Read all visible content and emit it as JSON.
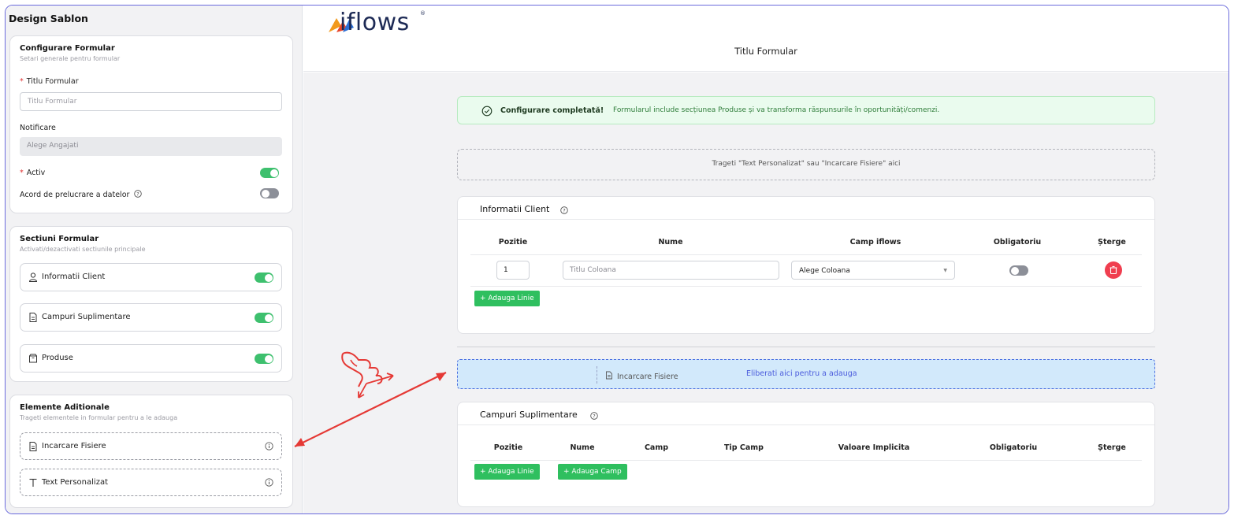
{
  "sidebar": {
    "title": "Design Sablon",
    "config": {
      "title": "Configurare Formular",
      "subtitle": "Setari generale pentru formular",
      "title_label": "Titlu Formular",
      "title_placeholder": "Titlu Formular",
      "notify_label": "Notificare",
      "notify_value": "Alege Angajati",
      "active_label": "Activ",
      "active_on": true,
      "gdpr_label": "Acord de prelucrare a datelor",
      "gdpr_on": false
    },
    "sections": {
      "title": "Sectiuni Formular",
      "subtitle": "Activati/dezactivati sectiunile principale",
      "items": [
        {
          "label": "Informatii Client",
          "icon": "user-icon",
          "on": true
        },
        {
          "label": "Campuri Suplimentare",
          "icon": "document-icon",
          "on": true
        },
        {
          "label": "Produse",
          "icon": "box-icon",
          "on": true
        }
      ]
    },
    "extras": {
      "title": "Elemente Aditionale",
      "subtitle": "Trageti elementele in formular pentru a le adauga",
      "items": [
        {
          "label": "Incarcare Fisiere",
          "icon": "file-icon"
        },
        {
          "label": "Text Personalizat",
          "icon": "text-icon"
        }
      ]
    }
  },
  "header": {
    "brand": "iflows",
    "form_title": "Titlu Formular"
  },
  "canvas": {
    "success_title": "Configurare completată!",
    "success_text": "Formularul include secțiunea Produse și va transforma răspunsurile în oportunități/comenzi.",
    "dropzone_text": "Trageti \"Text Personalizat\" sau \"Incarcare Fisiere\" aici",
    "client": {
      "title": "Informatii Client",
      "columns": [
        "Pozitie",
        "Nume",
        "Camp iflows",
        "Obligatoriu",
        "Șterge"
      ],
      "row": {
        "position": "1",
        "name_placeholder": "Titlu Coloana",
        "field": "Alege Coloana",
        "required": false
      },
      "add_line": "+ Adauga Linie"
    },
    "drop_active": {
      "ghost_label": "Incarcare Fisiere",
      "hint": "Eliberati aici pentru a adauga"
    },
    "extra_fields": {
      "title": "Campuri Suplimentare",
      "columns": [
        "Pozitie",
        "Nume",
        "Camp",
        "Tip Camp",
        "Valoare Implicita",
        "Obligatoriu",
        "Șterge"
      ],
      "add_line": "+ Adauga Linie",
      "add_field": "+ Adauga Camp"
    }
  },
  "colors": {
    "accent_green": "#2fbf5f",
    "toggle_on": "#3ec06e",
    "delete_red": "#f03e4f",
    "drop_blue": "#d2e9fb",
    "annotation_red": "#e53935"
  }
}
